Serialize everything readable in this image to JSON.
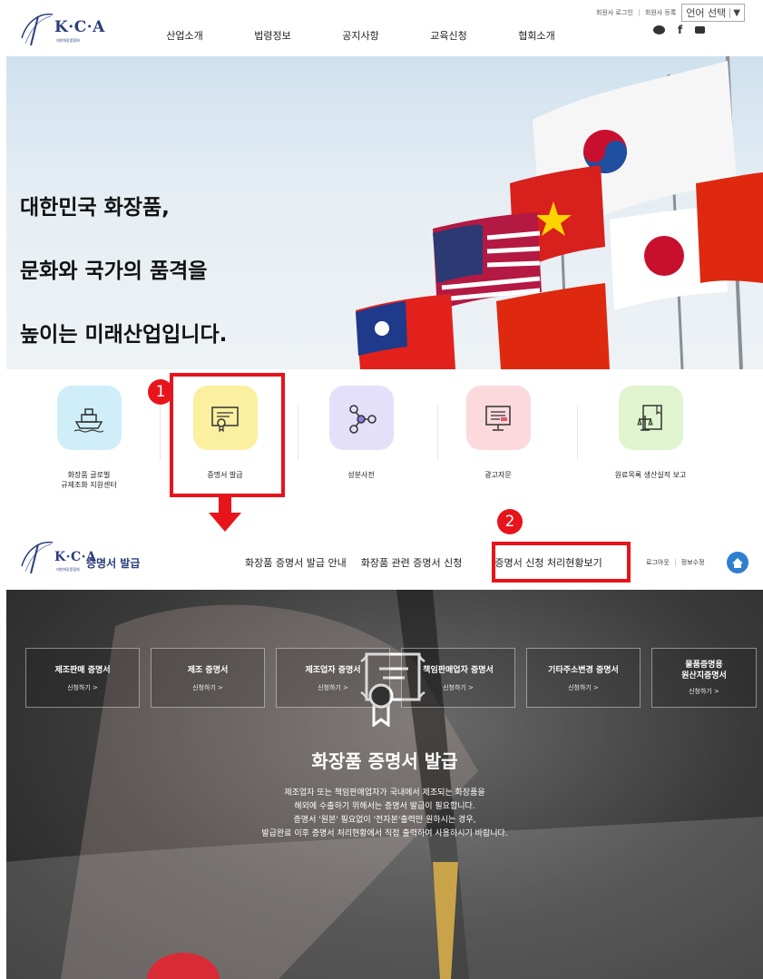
{
  "header": {
    "logo_text": "K·C·A",
    "logo_sub": "대한화장품협회",
    "util_links": [
      "회원사 로그인",
      "회원사 등록"
    ],
    "language": "언어 선택",
    "language_caret": "▼",
    "nav": [
      "산업소개",
      "법령정보",
      "공지사항",
      "교육신청",
      "협회소개"
    ],
    "social": [
      "blog-icon",
      "facebook-icon",
      "youtube-icon"
    ]
  },
  "hero": {
    "lines": [
      "대한민국 화장품,",
      "문화와 국가의 품격을",
      "높이는 미래산업입니다."
    ]
  },
  "quick_menu": [
    {
      "label": "화장품 글로벌\n규제조화 지원센터",
      "icon": "ship-icon",
      "color": "#cfeef9"
    },
    {
      "label": "증명서 발급",
      "icon": "certificate-icon",
      "color": "#fbefa0"
    },
    {
      "label": "성분사전",
      "icon": "molecule-icon",
      "color": "#e4e0fa"
    },
    {
      "label": "광고자문",
      "icon": "monitor-icon",
      "color": "#fbd9dd"
    },
    {
      "label": "원료목록 생산실적 보고",
      "icon": "book-scale-icon",
      "color": "#e0f5cf"
    }
  ],
  "badges": {
    "one": "1",
    "two": "2"
  },
  "sub_header": {
    "logo_title": "증명서 발급",
    "nav": [
      "화장품 증명서 발급 안내",
      "화장품 관련 증명서 신청",
      "증명서 신청 처리현황보기"
    ],
    "util": [
      "로그아웃",
      "정보수정"
    ]
  },
  "cert_banner": {
    "title": "화장품 증명서 발급",
    "desc": [
      "제조업자 또는 책임판매업자가 국내에서 제조되는 화장품을",
      "해외에 수출하기 위해서는 증명서 발급이 필요합니다.",
      "증명서 '원본' 필요없이 '전자본'출력만 원하시는 경우,",
      "발급완료 이후 증명서 처리현황에서 직접 출력하여 사용하시기 바랍니다."
    ],
    "cards": [
      {
        "title": "제조판매 증명서",
        "link": "신청하기 >"
      },
      {
        "title": "제조 증명서",
        "link": "신청하기 >"
      },
      {
        "title": "제조업자 증명서",
        "link": "신청하기 >"
      },
      {
        "title": "책임판매업자 증명서",
        "link": "신청하기 >"
      },
      {
        "title": "기타주소변경 증명서",
        "link": "신청하기 >"
      },
      {
        "title": "물품증명용\n원산지증명서",
        "link": "신청하기 >"
      }
    ]
  },
  "colors": {
    "accent_red": "#e8141b",
    "brand_navy": "#2a3d7a",
    "home_blue": "#2f7fd1"
  }
}
